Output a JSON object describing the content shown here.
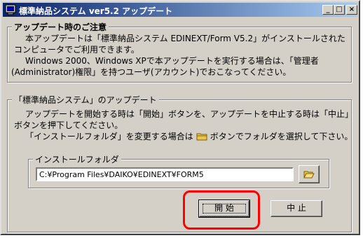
{
  "window": {
    "title": "標準納品システム  ver5.2 アップデート",
    "minimize_glyph": "_",
    "maximize_glyph": "□",
    "close_glyph": "×"
  },
  "notice": {
    "legend": "アップデート時のご注意",
    "lines": [
      "本アップデートは「標準納品システム EDINEXT/Form V5.2」がインストールされた",
      "コンピュータでご利用できます。",
      "Windows 2000、Windows XPで本アップデートを実行する場合は、「管理者",
      "(Administrator)権限」を持つユーザ(アカウント)でおこなってください。"
    ]
  },
  "update": {
    "legend": "「標準納品システム」のアップデート",
    "lines": [
      "アップデートを開始する時は「開始」ボタンを、アップデートを中止する時は「中止」",
      "ボタンを押下してください。"
    ],
    "folder_line_before": "「インストールフォルダ」を変更する場合は",
    "folder_line_after": "ボタンでフォルダを選択して下さい。"
  },
  "install": {
    "legend": "インストールフォルダ",
    "path": "C:¥Program Files¥DAIKO¥EDINEXT¥FORM5"
  },
  "buttons": {
    "start": "開 始",
    "cancel": "中 止"
  },
  "colors": {
    "face": "#d4d0c8",
    "title_start": "#0a246a",
    "title_end": "#a6caf0",
    "highlight": "#ff0000",
    "folder": "#e8c650"
  }
}
